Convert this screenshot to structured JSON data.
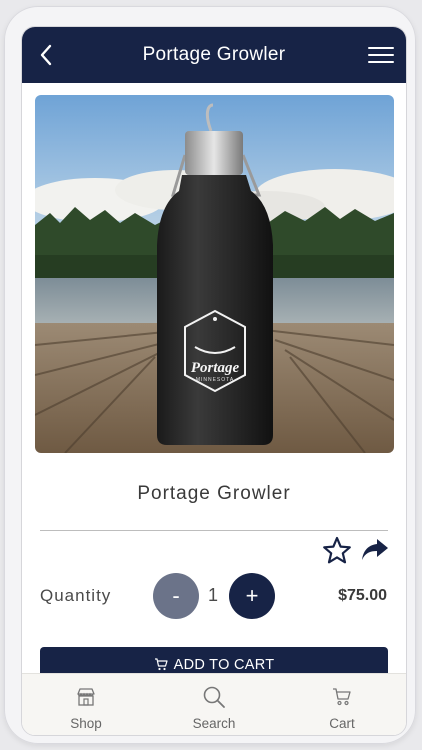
{
  "header": {
    "title": "Portage Growler",
    "back_icon": "chevron-left-icon",
    "menu_icon": "hamburger-menu-icon"
  },
  "product": {
    "name": "Portage Growler",
    "image_logo_text": "Portage",
    "image_logo_subtext": "MINNESOTA",
    "price": "$75.00"
  },
  "actions": {
    "favorite_icon": "star-outline-icon",
    "share_icon": "share-arrow-icon"
  },
  "quantity": {
    "label": "Quantity",
    "value": "1",
    "minus_label": "-",
    "plus_label": "+"
  },
  "cart_button": {
    "label": "ADD TO CART",
    "icon": "cart-icon"
  },
  "tabbar": {
    "items": [
      {
        "label": "Shop",
        "icon": "store-icon"
      },
      {
        "label": "Search",
        "icon": "search-icon"
      },
      {
        "label": "Cart",
        "icon": "cart-icon"
      }
    ]
  },
  "colors": {
    "primary": "#172346",
    "minus_button": "#6b7389",
    "tabbar_bg": "#f7f6f3"
  }
}
